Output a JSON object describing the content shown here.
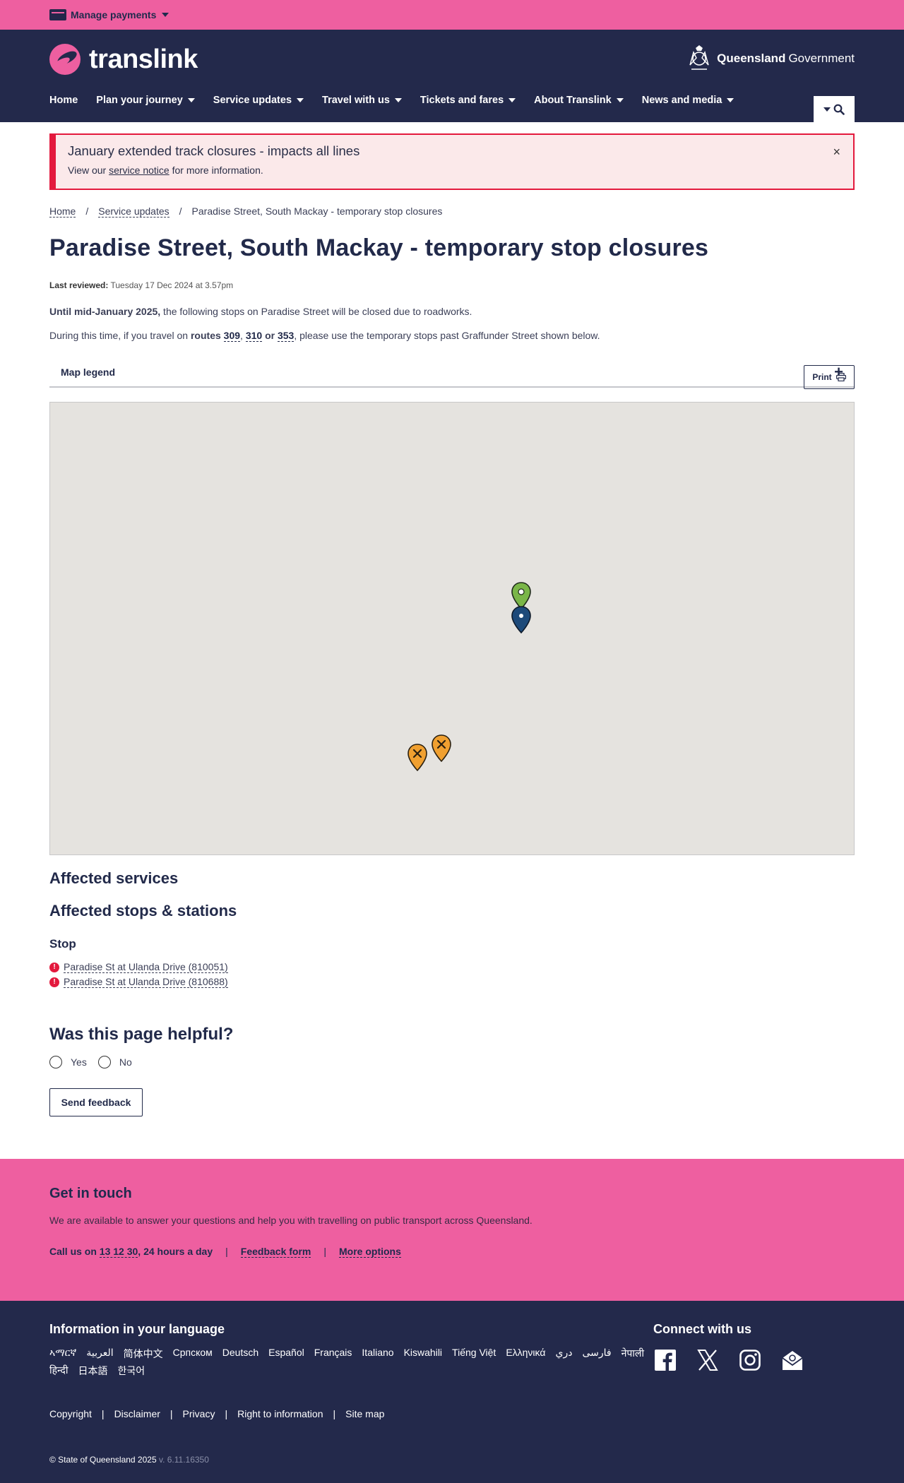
{
  "topbar": {
    "manage_payments": "Manage payments"
  },
  "header": {
    "logo_text": "translink",
    "gov_bold": "Queensland",
    "gov_rest": "Government",
    "nav": [
      "Home",
      "Plan your journey",
      "Service updates",
      "Travel with us",
      "Tickets and fares",
      "About Translink",
      "News and media"
    ]
  },
  "alert": {
    "title": "January extended track closures - impacts all lines",
    "msg_prefix": "View our ",
    "msg_link": "service notice",
    "msg_suffix": " for more information.",
    "close": "×"
  },
  "breadcrumb": {
    "home": "Home",
    "service_updates": "Service updates",
    "current": "Paradise Street, South Mackay - temporary stop closures",
    "sep": "/"
  },
  "page": {
    "title": "Paradise Street, South Mackay - temporary stop closures",
    "print": "Print",
    "last_reviewed_label": "Last reviewed:",
    "last_reviewed_value": " Tuesday 17 Dec 2024 at 3.57pm",
    "p1_bold": "Until mid-January 2025,",
    "p1_rest": " the following stops on Paradise Street will be closed due to roadworks.",
    "p2_a": "During this time, if you travel on ",
    "p2_routes": "routes",
    "route_309": "309",
    "comma": ",",
    "route_310": "310",
    "or": "or",
    "route_353": "353",
    "p2_b": ", please use the temporary stops past Graffunder Street shown below.",
    "map_legend": "Map legend",
    "plus": "+"
  },
  "map": {
    "pin_colors": {
      "temporary": "#7ab648",
      "closed": "#f0a030",
      "station": "#1d4a7a"
    }
  },
  "affected": {
    "services_heading": "Affected services",
    "stops_heading": "Affected stops & stations",
    "stop_label": "Stop",
    "stops": [
      "Paradise St at Ulanda Drive (810051)",
      "Paradise St at Ulanda Drive (810688)"
    ],
    "warn_glyph": "!"
  },
  "feedback": {
    "question": "Was this page helpful?",
    "yes": "Yes",
    "no": "No",
    "send": "Send feedback"
  },
  "touch": {
    "heading": "Get in touch",
    "text": "We are available to answer your questions and help you with travelling on public transport across Queensland.",
    "call_prefix": "Call us on ",
    "phone": "13 12 30",
    "call_suffix": ", 24 hours a day",
    "feedback_form": "Feedback form",
    "more_options": "More options",
    "bar": "|"
  },
  "footer": {
    "lang_heading": "Information in your language",
    "languages": [
      "ኣማርኛ",
      "العربية",
      "简体中文",
      "Српском",
      "Deutsch",
      "Español",
      "Français",
      "Italiano",
      "Kiswahili",
      "Tiếng Việt",
      "Ελληνικά",
      "دري",
      "فارسی",
      "नेपाली",
      "हिन्दी",
      "日本語",
      "한국어"
    ],
    "connect_heading": "Connect with us",
    "links": [
      "Copyright",
      "Disclaimer",
      "Privacy",
      "Right to information",
      "Site map"
    ],
    "bar": "|",
    "copyright": "© State of Queensland 2025",
    "version": " v. 6.11.16350"
  }
}
